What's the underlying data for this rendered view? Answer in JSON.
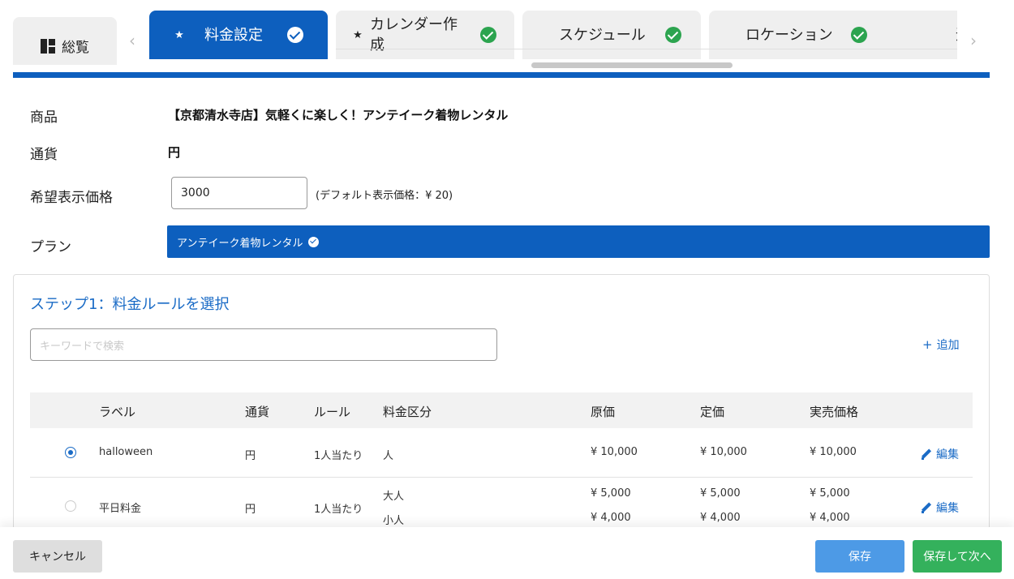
{
  "tabs": {
    "overview_label": "総覧",
    "items": [
      {
        "label": "料金設定",
        "active": true
      },
      {
        "label_line1": "カレンダー作",
        "label_line2": "成",
        "active": false
      },
      {
        "label": "スケジュール",
        "active": false
      },
      {
        "label": "ロケーション",
        "active": false
      },
      {
        "label": "追",
        "active": false
      }
    ]
  },
  "info": {
    "product_label": "商品",
    "product_value": "【京都清水寺店】気軽くに楽しく！アンテイーク着物レンタル",
    "currency_label": "通貨",
    "currency_value": "円",
    "price_label": "希望表示価格",
    "price_value": "3000",
    "price_note": "(デフォルト表示価格：¥ 20)",
    "plan_label": "プラン",
    "plan_value": "アンテイーク着物レンタル"
  },
  "step": {
    "title": "ステップ1：料金ルールを選択",
    "search_placeholder": "キーワードで検索",
    "add_label": "追加"
  },
  "table": {
    "headers": [
      "ラベル",
      "通貨",
      "ルール",
      "料金区分",
      "原価",
      "定価",
      "実売価格"
    ],
    "rows": [
      {
        "selected": true,
        "label": "halloween",
        "currency": "円",
        "rule": "1人当たり",
        "categories": [
          "人"
        ],
        "cost": [
          "¥ 10,000"
        ],
        "list_price": [
          "¥ 10,000"
        ],
        "sale_price": [
          "¥ 10,000"
        ],
        "edit": "編集"
      },
      {
        "selected": false,
        "label": "平日料金",
        "currency": "円",
        "rule": "1人当たり",
        "categories": [
          "大人",
          "小人"
        ],
        "cost": [
          "¥ 5,000",
          "¥ 4,000"
        ],
        "list_price": [
          "¥ 5,000",
          "¥ 4,000"
        ],
        "sale_price": [
          "¥ 5,000",
          "¥ 4,000"
        ],
        "edit": "編集"
      }
    ]
  },
  "footer": {
    "cancel": "キャンセル",
    "save": "保存",
    "save_next": "保存して次へ"
  },
  "colors": {
    "primary": "#0d5fbe",
    "success": "#2ca44f",
    "save_button": "#4d9ae6",
    "next_button": "#34b15c"
  }
}
